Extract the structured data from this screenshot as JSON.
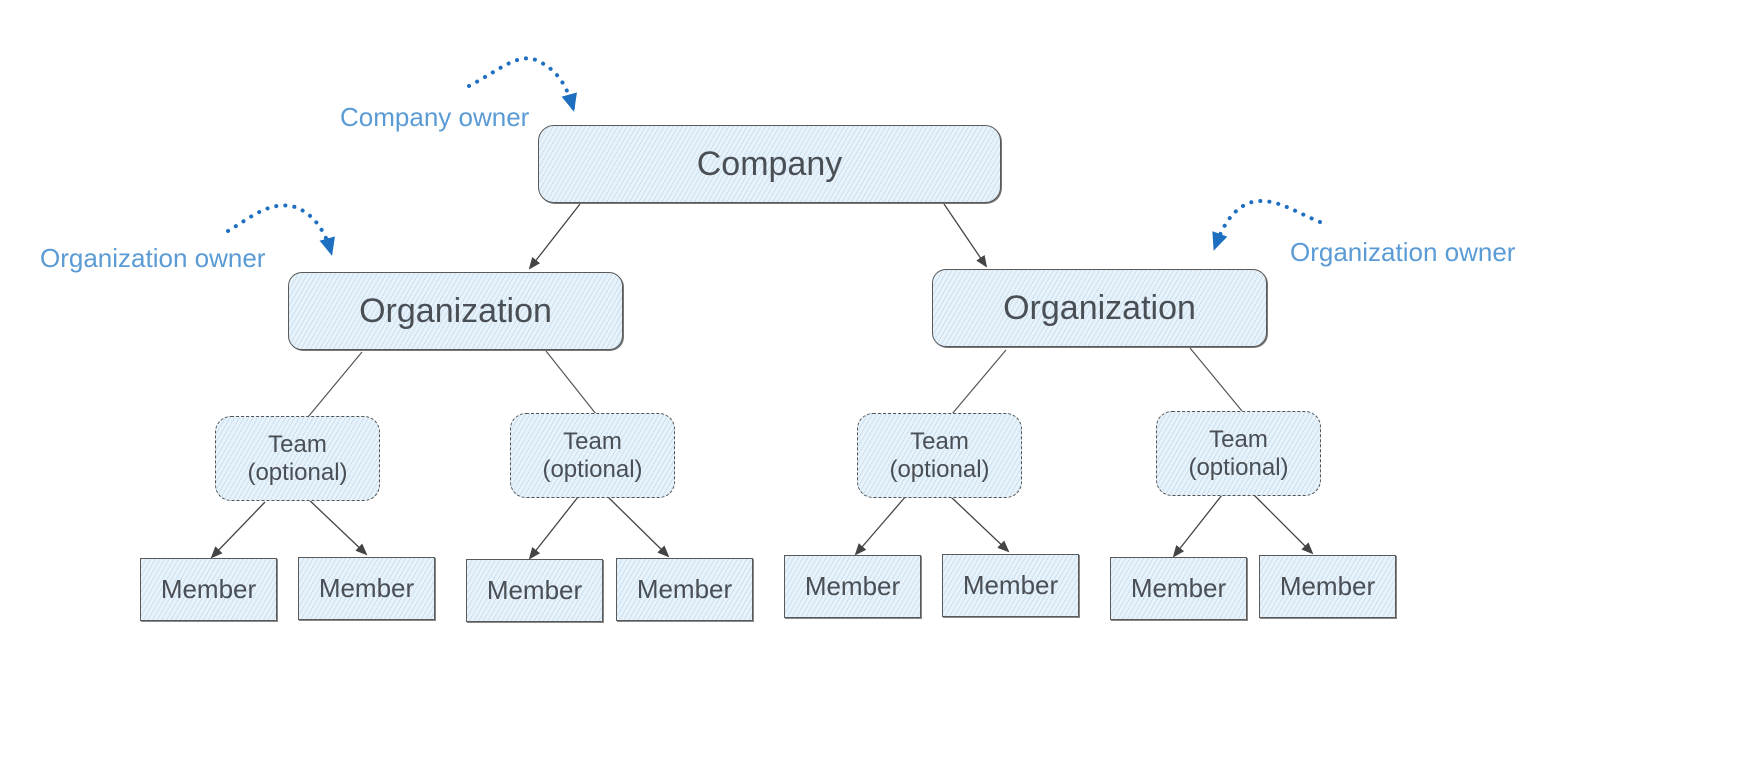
{
  "colors": {
    "annotation": "#5b9bd5",
    "arrow_blue": "#1f6fc0",
    "node_fill": "#e7f2fa",
    "text": "#4a4f55",
    "stroke": "#555555"
  },
  "company": {
    "label": "Company"
  },
  "annotations": {
    "company_owner": "Company owner",
    "org_owner_left": "Organization owner",
    "org_owner_right": "Organization owner"
  },
  "organizations": [
    {
      "label": "Organization",
      "teams": [
        {
          "label": "Team (optional)",
          "members": [
            "Member",
            "Member"
          ]
        },
        {
          "label": "Team (optional)",
          "members": [
            "Member",
            "Member"
          ]
        }
      ]
    },
    {
      "label": "Organization",
      "teams": [
        {
          "label": "Team (optional)",
          "members": [
            "Member",
            "Member"
          ]
        },
        {
          "label": "Team (optional)",
          "members": [
            "Member",
            "Member"
          ]
        }
      ]
    }
  ]
}
